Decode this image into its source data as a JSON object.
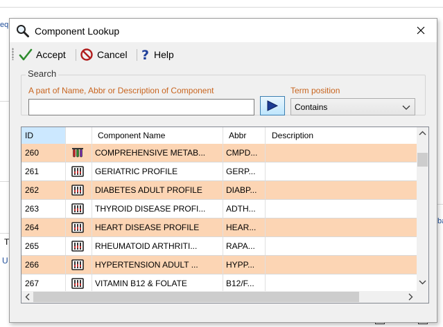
{
  "background": {
    "left_fragment": "equ",
    "left_fragment_2": "T",
    "left_fragment_3": "U",
    "right_fragment": "ba"
  },
  "dialog": {
    "title": "Component Lookup",
    "title_icon": "magnifier-icon",
    "close_icon": "close-icon"
  },
  "toolbar": {
    "accept_label": "Accept",
    "cancel_label": "Cancel",
    "help_label": "Help"
  },
  "search": {
    "group_label": "Search",
    "field_label": "A part of Name, Abbr or Description of Component",
    "field_value": "",
    "term_label": "Term position",
    "term_value": "Contains"
  },
  "grid": {
    "columns": [
      "ID",
      "",
      "Component Name",
      "Abbr",
      "Description"
    ],
    "rows": [
      {
        "id": "260",
        "name": "COMPREHENSIVE METAB...",
        "abbr": "CMPD...",
        "description": "",
        "icon": "test-tubes-icon"
      },
      {
        "id": "261",
        "name": "GERIATRIC PROFILE",
        "abbr": "GERP...",
        "description": "",
        "icon": "test-rack-icon"
      },
      {
        "id": "262",
        "name": "DIABETES ADULT PROFILE",
        "abbr": "DIABP...",
        "description": "",
        "icon": "test-rack-icon"
      },
      {
        "id": "263",
        "name": "THYROID DISEASE PROFI...",
        "abbr": "ADTH...",
        "description": "",
        "icon": "test-rack-icon"
      },
      {
        "id": "264",
        "name": "HEART DISEASE PROFILE",
        "abbr": "HEAR...",
        "description": "",
        "icon": "test-rack-icon"
      },
      {
        "id": "265",
        "name": "RHEUMATOID ARTHRITI...",
        "abbr": "RAPA...",
        "description": "",
        "icon": "test-rack-icon"
      },
      {
        "id": "266",
        "name": "HYPERTENSION ADULT ...",
        "abbr": "HYPP...",
        "description": "",
        "icon": "test-rack-icon"
      },
      {
        "id": "267",
        "name": "VITAMIN B12 & FOLATE",
        "abbr": "B12/F...",
        "description": "",
        "icon": "test-rack-icon"
      }
    ]
  },
  "colors": {
    "alt_row": "#fcd5b4",
    "accent_orange": "#c8641e",
    "header_selected": "#cce8ff"
  }
}
